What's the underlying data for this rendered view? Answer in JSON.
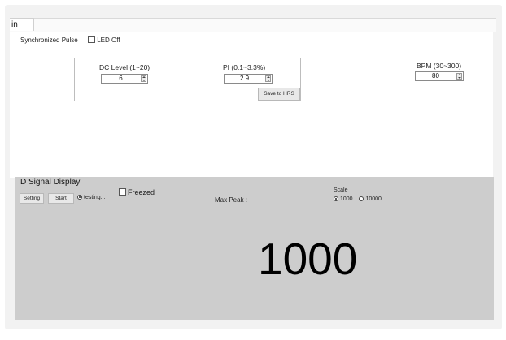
{
  "tab": {
    "label": "in"
  },
  "top": {
    "sync_label": "Synchronized Pulse",
    "led_label": "LED Off",
    "dc_level": {
      "label": "DC Level (1~20)",
      "value": "6"
    },
    "pi": {
      "label": "PI (0.1~3.3%)",
      "value": "2.9"
    },
    "save_button": "Save to HRS",
    "bpm": {
      "label": "BPM (30~300)",
      "value": "80"
    }
  },
  "signal": {
    "title": "D Signal Display",
    "setting_button": "Setting",
    "start_button": "Start",
    "testing_label": "testing...",
    "freezed_label": "Freezed",
    "max_peak_label": "Max Peak :",
    "scale": {
      "label": "Scale",
      "options": [
        "1000",
        "10000"
      ],
      "selected": "1000"
    },
    "display_value": "1000"
  }
}
